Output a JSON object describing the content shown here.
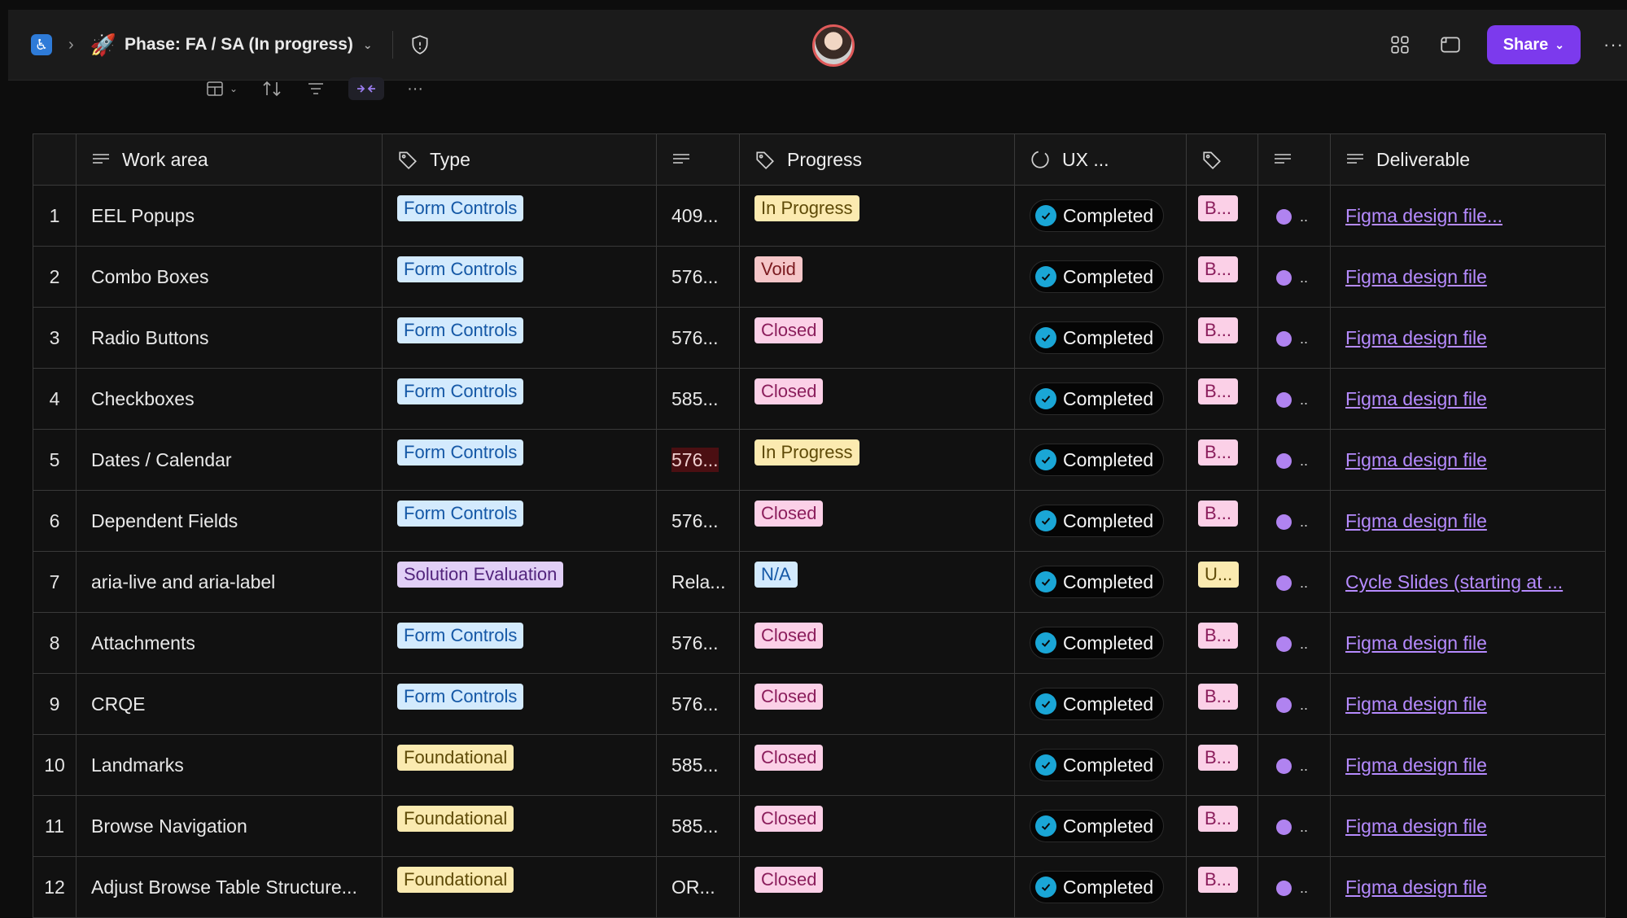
{
  "topbar": {
    "phase_title": "Phase: FA / SA (In progress)",
    "share_label": "Share",
    "more_label": "···"
  },
  "toolbar": {
    "more_label": "···"
  },
  "columns": {
    "work_area": "Work area",
    "type": "Type",
    "notes": "",
    "progress": "Progress",
    "ux": "UX ...",
    "tag": "",
    "text2": "",
    "deliverable": "Deliverable"
  },
  "colors": {
    "accent": "#7c3aed",
    "link": "#b68bff",
    "form_controls_bg": "#d3eafd",
    "form_controls_fg": "#1558a6",
    "foundational_bg": "#faeab0",
    "foundational_fg": "#5e4a07",
    "solution_bg": "#e1cff6",
    "solution_fg": "#52247c",
    "in_progress_bg": "#fbeab0",
    "void_bg": "#f5c6c8",
    "closed_bg": "#fbd0e7",
    "na_bg": "#d3eafd",
    "completed_check": "#1aa6d6"
  },
  "rows": [
    {
      "num": "1",
      "work_area": "EEL Popups",
      "type": "Form Controls",
      "notes": "409...",
      "progress": "In Progress",
      "ux": "Completed",
      "tag": "B...",
      "text2": "..",
      "deliverable": "Figma design file..."
    },
    {
      "num": "2",
      "work_area": "Combo Boxes",
      "type": "Form Controls",
      "notes": "576...",
      "progress": "Void",
      "ux": "Completed",
      "tag": "B...",
      "text2": "..",
      "deliverable": "Figma design file"
    },
    {
      "num": "3",
      "work_area": "Radio Buttons",
      "type": "Form Controls",
      "notes": "576...",
      "progress": "Closed",
      "ux": "Completed",
      "tag": "B...",
      "text2": "..",
      "deliverable": "Figma design file"
    },
    {
      "num": "4",
      "work_area": "Checkboxes",
      "type": "Form Controls",
      "notes": "585...",
      "progress": "Closed",
      "ux": "Completed",
      "tag": "B...",
      "text2": "..",
      "deliverable": "Figma design file"
    },
    {
      "num": "5",
      "work_area": "Dates / Calendar",
      "type": "Form Controls",
      "notes": "576...",
      "progress": "In Progress",
      "ux": "Completed",
      "tag": "B...",
      "text2": "..",
      "deliverable": "Figma design file"
    },
    {
      "num": "6",
      "work_area": "Dependent Fields",
      "type": "Form Controls",
      "notes": "576...",
      "progress": "Closed",
      "ux": "Completed",
      "tag": "B...",
      "text2": "..",
      "deliverable": "Figma design file"
    },
    {
      "num": "7",
      "work_area": "aria-live and aria-label",
      "type": "Solution Evaluation",
      "notes": "Rela...",
      "progress": "N/A",
      "ux": "Completed",
      "tag": "U...",
      "text2": "..",
      "deliverable": "Cycle Slides (starting at ..."
    },
    {
      "num": "8",
      "work_area": "Attachments",
      "type": "Form Controls",
      "notes": "576...",
      "progress": "Closed",
      "ux": "Completed",
      "tag": "B...",
      "text2": "..",
      "deliverable": "Figma design file"
    },
    {
      "num": "9",
      "work_area": "CRQE",
      "type": "Form Controls",
      "notes": "576...",
      "progress": "Closed",
      "ux": "Completed",
      "tag": "B...",
      "text2": "..",
      "deliverable": "Figma design file"
    },
    {
      "num": "10",
      "work_area": "Landmarks",
      "type": "Foundational",
      "notes": "585...",
      "progress": "Closed",
      "ux": "Completed",
      "tag": "B...",
      "text2": "..",
      "deliverable": "Figma design file"
    },
    {
      "num": "11",
      "work_area": "Browse Navigation",
      "type": "Foundational",
      "notes": "585...",
      "progress": "Closed",
      "ux": "Completed",
      "tag": "B...",
      "text2": "..",
      "deliverable": "Figma design file"
    },
    {
      "num": "12",
      "work_area": "Adjust Browse Table Structure...",
      "type": "Foundational",
      "notes": "OR...",
      "progress": "Closed",
      "ux": "Completed",
      "tag": "B...",
      "text2": "..",
      "deliverable": "Figma design file"
    }
  ]
}
